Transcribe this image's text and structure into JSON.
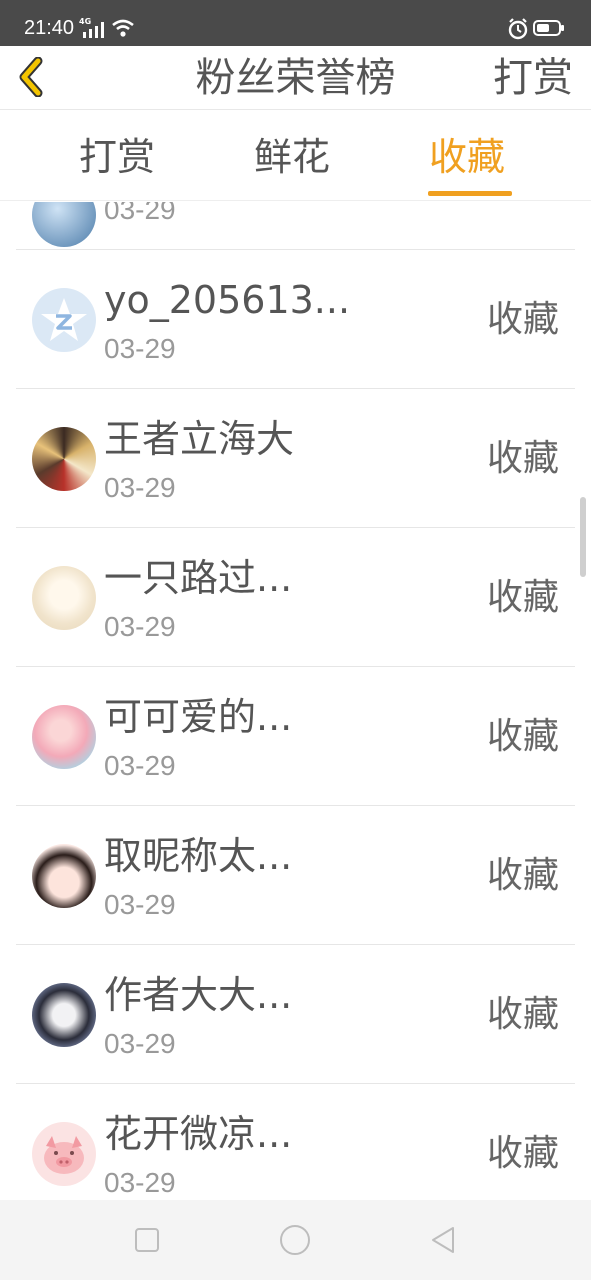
{
  "status_bar": {
    "time": "21:40",
    "network": "4G"
  },
  "header": {
    "title": "粉丝荣誉榜",
    "right_action": "打赏"
  },
  "tabs": [
    {
      "label": "打赏",
      "active": false
    },
    {
      "label": "鲜花",
      "active": false
    },
    {
      "label": "收藏",
      "active": true
    }
  ],
  "accent_color": "#f0a020",
  "list": [
    {
      "name": "",
      "date": "03-29",
      "action": ""
    },
    {
      "name": "yo_205613...",
      "date": "03-29",
      "action": "收藏"
    },
    {
      "name": "王者立海大",
      "date": "03-29",
      "action": "收藏"
    },
    {
      "name": "一只路过...",
      "date": "03-29",
      "action": "收藏"
    },
    {
      "name": "可可爱的...",
      "date": "03-29",
      "action": "收藏"
    },
    {
      "name": "取昵称太...",
      "date": "03-29",
      "action": "收藏"
    },
    {
      "name": "作者大大...",
      "date": "03-29",
      "action": "收藏"
    },
    {
      "name": "花开微凉...",
      "date": "03-29",
      "action": "收藏"
    }
  ],
  "nav": {
    "buttons": [
      "recents-icon",
      "home-icon",
      "back-icon"
    ]
  }
}
